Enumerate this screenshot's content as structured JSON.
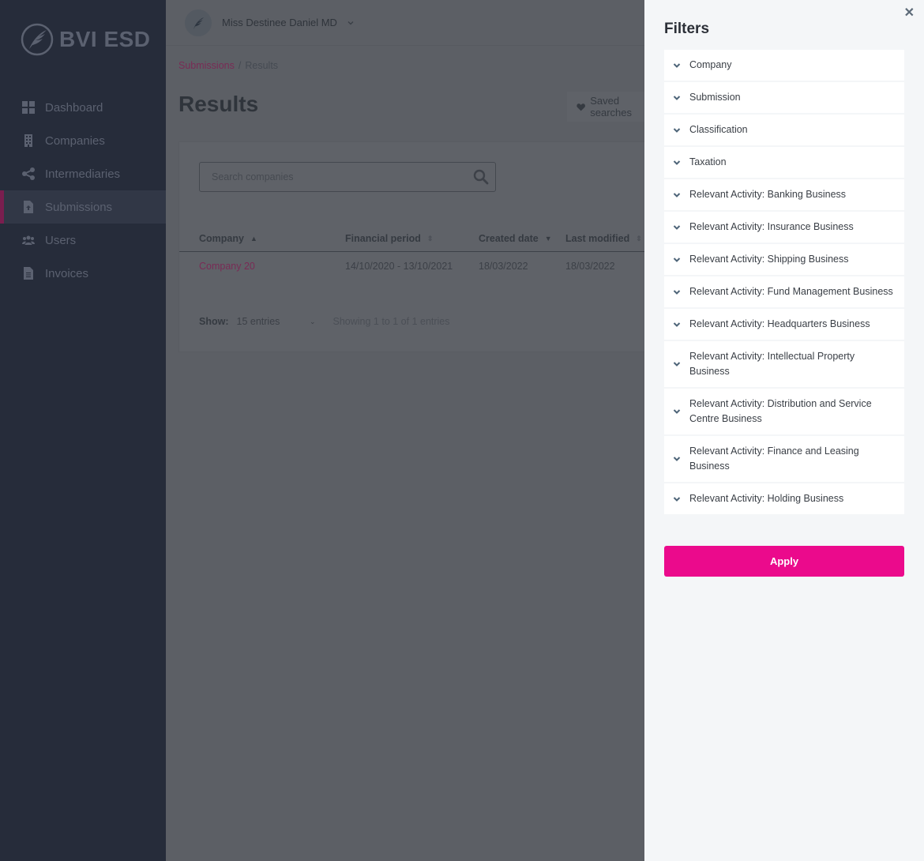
{
  "app": {
    "logo_text": "BVI ESD"
  },
  "sidebar": {
    "items": [
      {
        "label": "Dashboard",
        "icon": "dashboard-icon",
        "active": false
      },
      {
        "label": "Companies",
        "icon": "building-icon",
        "active": false
      },
      {
        "label": "Intermediaries",
        "icon": "share-icon",
        "active": false
      },
      {
        "label": "Submissions",
        "icon": "file-upload-icon",
        "active": true
      },
      {
        "label": "Users",
        "icon": "users-icon",
        "active": false
      },
      {
        "label": "Invoices",
        "icon": "file-text-icon",
        "active": false
      }
    ]
  },
  "topbar": {
    "user_name": "Miss Destinee Daniel MD"
  },
  "breadcrumb": {
    "parent": "Submissions",
    "separator": "/",
    "current": "Results"
  },
  "page": {
    "title": "Results",
    "saved_searches_label": "Saved searches"
  },
  "search": {
    "placeholder": "Search companies",
    "value": ""
  },
  "table": {
    "columns": [
      {
        "label": "Company",
        "sort": "asc"
      },
      {
        "label": "Financial period",
        "sort": "none"
      },
      {
        "label": "Created date",
        "sort": "desc"
      },
      {
        "label": "Last modified",
        "sort": "none"
      }
    ],
    "rows": [
      {
        "company": "Company 20",
        "financial_period": "14/10/2020 - 13/10/2021",
        "created_date": "18/03/2022",
        "last_modified": "18/03/2022"
      }
    ]
  },
  "pagination": {
    "show_label": "Show:",
    "entries_option": "15 entries",
    "summary": "Showing 1 to 1 of 1 entries"
  },
  "filters": {
    "title": "Filters",
    "close_icon": "close-icon",
    "items": [
      "Company",
      "Submission",
      "Classification",
      "Taxation",
      "Relevant Activity: Banking Business",
      "Relevant Activity: Insurance Business",
      "Relevant Activity: Shipping Business",
      "Relevant Activity: Fund Management Business",
      "Relevant Activity: Headquarters Business",
      "Relevant Activity: Intellectual Property Business",
      "Relevant Activity: Distribution and Service Centre Business",
      "Relevant Activity: Finance and Leasing Business",
      "Relevant Activity: Holding Business"
    ],
    "apply_label": "Apply"
  },
  "colors": {
    "accent": "#eb0a8c",
    "sidebar_bg": "#262c3a",
    "overlay": "#5c5f65",
    "panel_bg": "#f4f6f8"
  }
}
